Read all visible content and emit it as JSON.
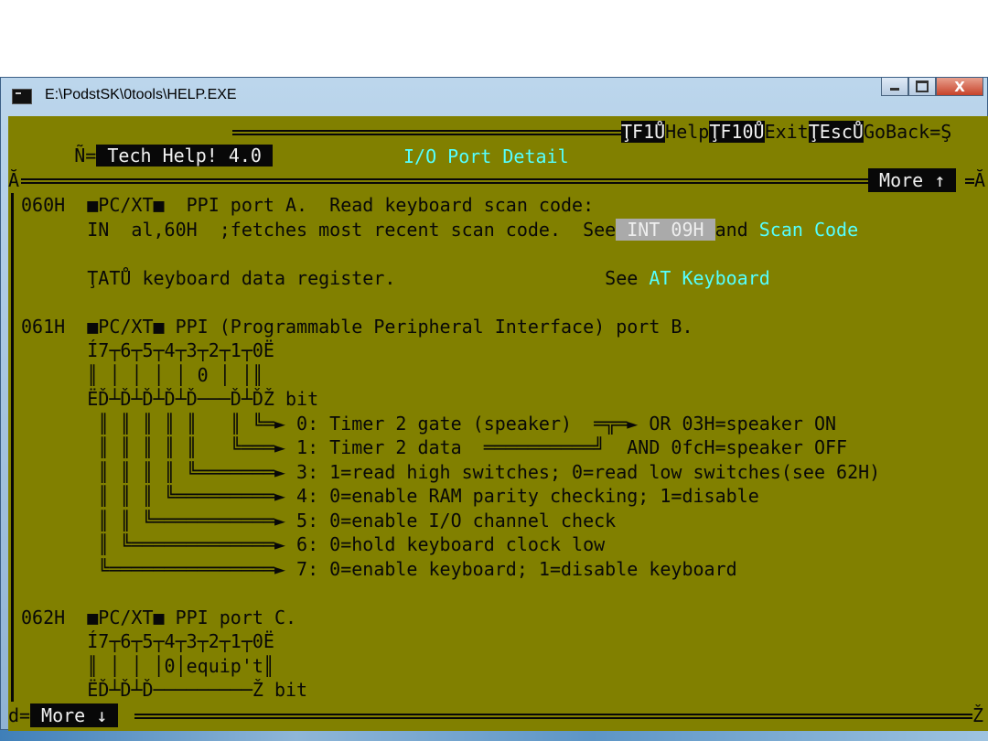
{
  "window": {
    "title": "E:\\PodstSK\\0tools\\HELP.EXE",
    "min_icon": "minimize-icon",
    "max_icon": "maximize-icon",
    "close_label": "X"
  },
  "header": {
    "corner_left": "Ñ=",
    "app_name": " Tech Help! 4.0 ",
    "menu": [
      {
        "key": "ŢF1Ů",
        "label": "Help"
      },
      {
        "key": "ŢF10Ů",
        "label": "Exit"
      },
      {
        "key": "ŢEscŮ",
        "label": "GoBack"
      }
    ],
    "corner_right": "=Ş",
    "subtitle": "I/O Port Detail",
    "left_edge_mark": "Ă",
    "right_edge_mark": "Ă",
    "more_up": " More ↑ "
  },
  "lines": [
    {
      "parts": [
        {
          "t": "060H  ",
          "s": "c-b"
        },
        {
          "t": "■PC/XT■  PPI port A.  Read keyboard scan code:",
          "s": "c-b"
        }
      ]
    },
    {
      "parts": [
        {
          "t": "      IN  al,60H  ;fetches most recent scan code.  See",
          "s": "c-b"
        },
        {
          "t": " INT 09H ",
          "s": "gray"
        },
        {
          "t": "and ",
          "s": "c-b"
        },
        {
          "t": "Scan Code",
          "s": "c-c"
        }
      ]
    },
    {
      "parts": [
        {
          "t": "",
          "s": "c-b"
        }
      ]
    },
    {
      "parts": [
        {
          "t": "      ŢATŮ keyboard data register.                   See ",
          "s": "c-b"
        },
        {
          "t": "AT Keyboard",
          "s": "c-c"
        }
      ]
    },
    {
      "parts": [
        {
          "t": "",
          "s": "c-b"
        }
      ]
    },
    {
      "parts": [
        {
          "t": "061H  ■PC/XT■ PPI (Programmable Peripheral Interface) port B.",
          "s": "c-b"
        }
      ]
    },
    {
      "parts": [
        {
          "t": "      Í7┬6┬5┬4┬3┬2┬1┬0Ë",
          "s": "c-b"
        }
      ]
    },
    {
      "parts": [
        {
          "t": "      ║ │ │ │ │ 0 │ │║",
          "s": "c-b"
        }
      ]
    },
    {
      "parts": [
        {
          "t": "      ËĎ┴Ď┴Ď┴Ď┴Ď───Ď┴ĎŽ bit",
          "s": "c-b"
        }
      ]
    },
    {
      "parts": [
        {
          "t": "       ║ ║ ║ ║ ║   ║ ╚═►",
          "s": "c-b"
        },
        {
          "t": " 0: Timer 2 gate (speaker)  ═╦═► OR 03H=speaker ON",
          "s": "c-b"
        }
      ]
    },
    {
      "parts": [
        {
          "t": "       ║ ║ ║ ║ ║   ╚═══►",
          "s": "c-b"
        },
        {
          "t": " 1: Timer 2 data  ══════════╝  AND 0fcH=speaker OFF",
          "s": "c-b"
        }
      ]
    },
    {
      "parts": [
        {
          "t": "       ║ ║ ║ ║ ╚═══════►",
          "s": "c-b"
        },
        {
          "t": " 3: 1=read high switches; 0=read low switches(see 62H)",
          "s": "c-b"
        }
      ]
    },
    {
      "parts": [
        {
          "t": "       ║ ║ ║ ╚═════════►",
          "s": "c-b"
        },
        {
          "t": " 4: 0=enable RAM parity checking; 1=disable",
          "s": "c-b"
        }
      ]
    },
    {
      "parts": [
        {
          "t": "       ║ ║ ╚═══════════►",
          "s": "c-b"
        },
        {
          "t": " 5: 0=enable I/O channel check",
          "s": "c-b"
        }
      ]
    },
    {
      "parts": [
        {
          "t": "       ║ ╚═════════════►",
          "s": "c-b"
        },
        {
          "t": " 6: 0=hold keyboard clock low",
          "s": "c-b"
        }
      ]
    },
    {
      "parts": [
        {
          "t": "       ╚═══════════════►",
          "s": "c-b"
        },
        {
          "t": " 7: 0=enable keyboard; 1=disable keyboard",
          "s": "c-b"
        }
      ]
    },
    {
      "parts": [
        {
          "t": "",
          "s": "c-b"
        }
      ]
    },
    {
      "parts": [
        {
          "t": "062H  ■PC/XT■ PPI port C.",
          "s": "c-b"
        }
      ]
    },
    {
      "parts": [
        {
          "t": "      Í7┬6┬5┬4┬3┬2┬1┬0Ë",
          "s": "c-b"
        }
      ]
    },
    {
      "parts": [
        {
          "t": "      ║ │ │ │0│equip't║",
          "s": "c-b"
        }
      ]
    },
    {
      "parts": [
        {
          "t": "      ËĎ┴Ď┴Ď─────────Ž bit",
          "s": "c-b"
        }
      ]
    }
  ],
  "footer": {
    "corner_left": "d=",
    "more_down": " More ↓ ",
    "corner_right": "Ž"
  },
  "colors": {
    "console_bg": "#818000",
    "text_dark": "#080808",
    "link_cyan": "#55ffff",
    "title_yellow": "#ffff55",
    "highlight_gray": "#aaaaaa"
  }
}
